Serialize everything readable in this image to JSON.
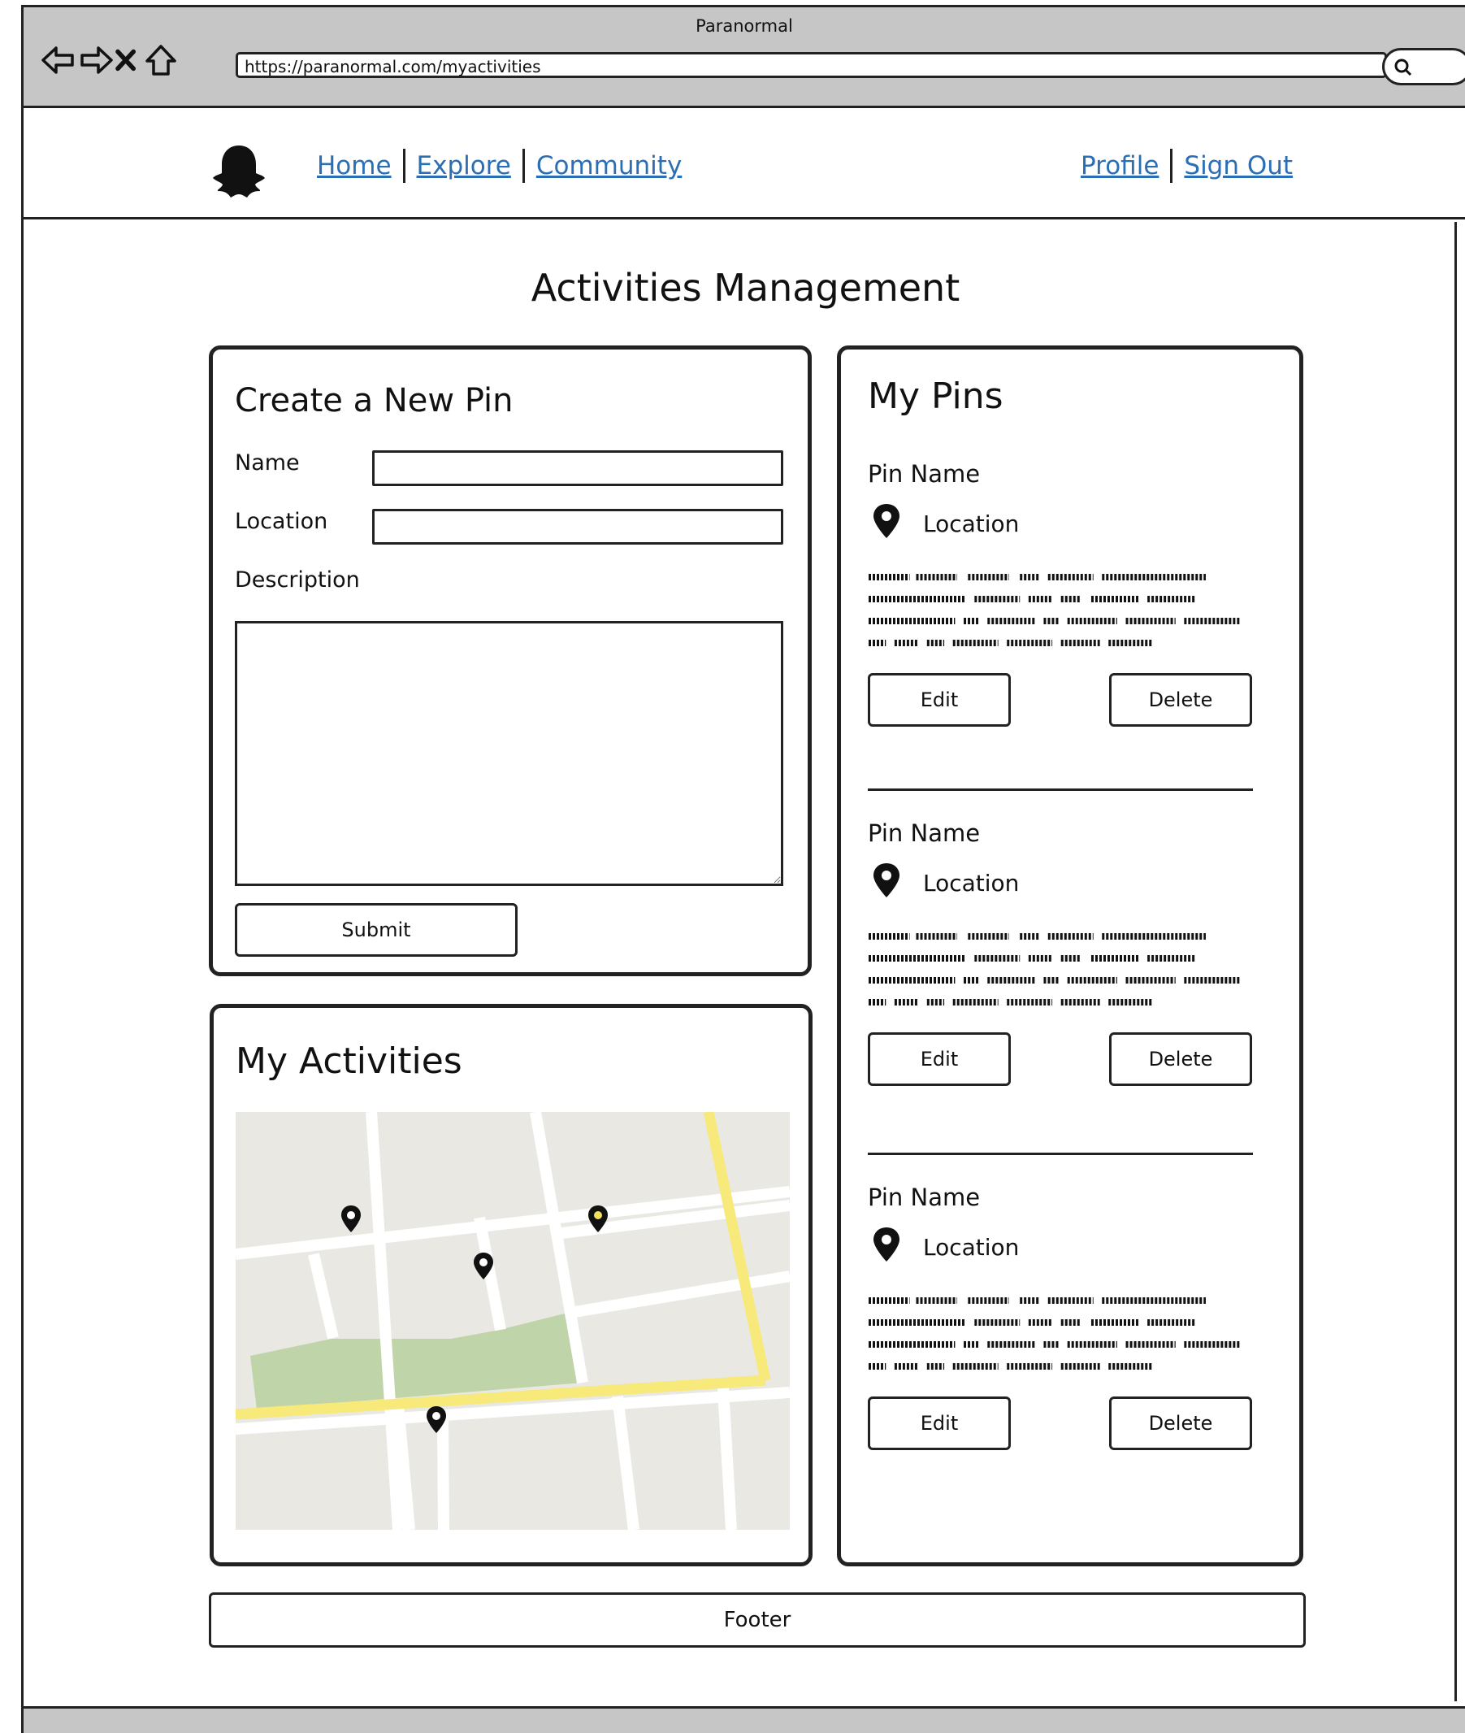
{
  "browser": {
    "window_title": "Paranormal",
    "url": "https://paranormal.com/myactivities",
    "nav_icons": [
      "back-arrow-icon",
      "forward-arrow-icon",
      "close-x-icon",
      "home-icon"
    ],
    "search_icon": "search-icon"
  },
  "header": {
    "logo_icon": "ghost-logo-icon",
    "nav_left": [
      "Home",
      "Explore",
      "Community"
    ],
    "nav_right": [
      "Profile",
      "Sign Out"
    ],
    "link_color": "#2a6fb5"
  },
  "page": {
    "title": "Activities Management"
  },
  "create_pin": {
    "heading": "Create a New Pin",
    "name_label": "Name",
    "name_value": "",
    "location_label": "Location",
    "location_value": "",
    "description_label": "Description",
    "description_value": "",
    "submit_label": "Submit"
  },
  "my_activities": {
    "heading": "My Activities",
    "map_colors": {
      "land": "#e9e8e2",
      "road": "#ffffff",
      "main_road": "#f7e97a",
      "park": "#bfd4a8",
      "marker": "#111111",
      "marker_highlight": "#f2e15a"
    },
    "marker_count": 4
  },
  "my_pins": {
    "heading": "My Pins",
    "pins": [
      {
        "name": "Pin Name",
        "location": "Location",
        "edit_label": "Edit",
        "delete_label": "Delete"
      },
      {
        "name": "Pin Name",
        "location": "Location",
        "edit_label": "Edit",
        "delete_label": "Delete"
      },
      {
        "name": "Pin Name",
        "location": "Location",
        "edit_label": "Edit",
        "delete_label": "Delete"
      }
    ]
  },
  "footer": {
    "label": "Footer"
  }
}
